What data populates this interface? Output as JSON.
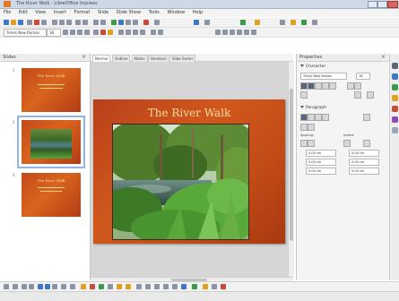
{
  "window": {
    "title": "The River Walk - LibreOffice Impress"
  },
  "menu": [
    "File",
    "Edit",
    "View",
    "Insert",
    "Format",
    "Slide",
    "Slide Show",
    "Tools",
    "Window",
    "Help"
  ],
  "toolbar2": {
    "font_name": "Times New Roman",
    "font_size": "18"
  },
  "slides_pane": {
    "title": "Slides",
    "slides": [
      {
        "number": "1",
        "title": "The River Walk"
      },
      {
        "number": "2",
        "title": ""
      },
      {
        "number": "3",
        "title": "The River Walk"
      }
    ]
  },
  "view_tabs": [
    "Normal",
    "Outline",
    "Notes",
    "Handout",
    "Slide Sorter"
  ],
  "main_slide": {
    "title": "The River Walk"
  },
  "properties": {
    "title": "Properties",
    "character_label": "Character",
    "font_name": "Times New Roman",
    "font_size": "18",
    "paragraph_label": "Paragraph",
    "spacing_label": "Spacing:",
    "indent_label": "Indent:",
    "before": "0.00 cm",
    "after": "0.00 cm",
    "before_indent": "0.00 cm",
    "after_indent": "0.00 cm",
    "first_line": "0.00 cm",
    "line": "0.00 cm"
  },
  "colors": {
    "slide_bg": "#c24c18",
    "title_text": "#f6dca0",
    "selection": "#8fb4e6"
  }
}
